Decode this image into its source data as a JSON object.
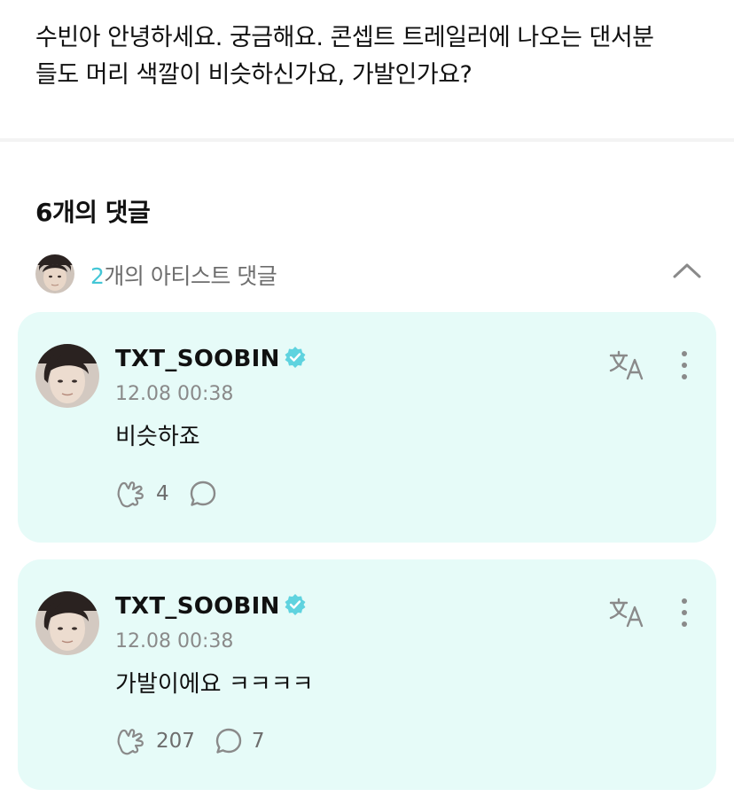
{
  "post": {
    "text": "수빈아 안녕하세요. 궁금해요. 콘셉트 트레일러에 나오는 댄서분\n들도 머리 색깔이 비슷하신가요, 가발인가요?"
  },
  "comments_section": {
    "title": "6개의 댓글",
    "artist_comments": {
      "count": "2",
      "label": "개의 아티스트 댓글",
      "collapse_icon": "chevron-up-icon"
    }
  },
  "comments": [
    {
      "author": "TXT_SOOBIN",
      "verified": true,
      "timestamp": "12.08 00:38",
      "text": "비슷하죠",
      "likes": "4",
      "replies": ""
    },
    {
      "author": "TXT_SOOBIN",
      "verified": true,
      "timestamp": "12.08 00:38",
      "text": "가발이에요 ㅋㅋㅋㅋ",
      "likes": "207",
      "replies": "7"
    }
  ],
  "icons": {
    "translate": "translate-icon",
    "more": "more-vertical-icon",
    "like": "cheer-icon",
    "reply": "comment-bubble-icon",
    "verified": "verified-badge-icon"
  },
  "colors": {
    "card_background": "#e6fbf8",
    "accent": "#43c6d6",
    "verified_badge": "#5fd3df",
    "muted_text": "#6d6d6d"
  }
}
